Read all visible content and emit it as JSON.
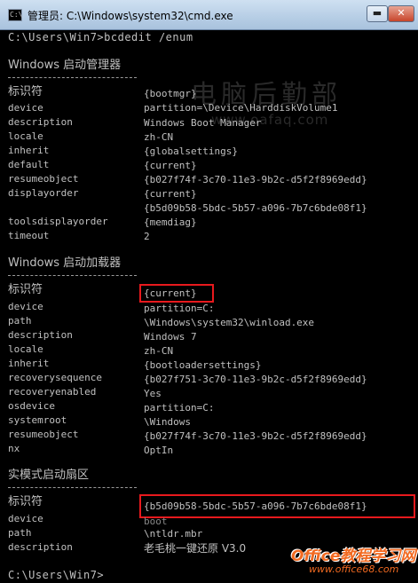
{
  "window": {
    "title": "管理员: C:\\Windows\\system32\\cmd.exe",
    "icon": "cmd-icon"
  },
  "prompt_command": "C:\\Users\\Win7>bcdedit /enum",
  "watermark": {
    "text": "电脑后勤部",
    "url": "www.oafaq.com"
  },
  "sections": [
    {
      "heading": "Windows 启动管理器",
      "entries": [
        {
          "key": "标识符",
          "value": "{bootmgr}"
        },
        {
          "key": "device",
          "value": "partition=\\Device\\HarddiskVolume1"
        },
        {
          "key": "description",
          "value": "Windows Boot Manager"
        },
        {
          "key": "locale",
          "value": "zh-CN"
        },
        {
          "key": "inherit",
          "value": "{globalsettings}"
        },
        {
          "key": "default",
          "value": "{current}"
        },
        {
          "key": "resumeobject",
          "value": "{b027f74f-3c70-11e3-9b2c-d5f2f8969edd}"
        },
        {
          "key": "displayorder",
          "value": "{current}"
        },
        {
          "key": "",
          "value": "{b5d09b58-5bdc-5b57-a096-7b7c6bde08f1}"
        },
        {
          "key": "toolsdisplayorder",
          "value": "{memdiag}"
        },
        {
          "key": "timeout",
          "value": "2"
        }
      ]
    },
    {
      "heading": "Windows 启动加载器",
      "entries": [
        {
          "key": "标识符",
          "value": "{current}"
        },
        {
          "key": "device",
          "value": "partition=C:"
        },
        {
          "key": "path",
          "value": "\\Windows\\system32\\winload.exe"
        },
        {
          "key": "description",
          "value": "Windows 7"
        },
        {
          "key": "locale",
          "value": "zh-CN"
        },
        {
          "key": "inherit",
          "value": "{bootloadersettings}"
        },
        {
          "key": "recoverysequence",
          "value": "{b027f751-3c70-11e3-9b2c-d5f2f8969edd}"
        },
        {
          "key": "recoveryenabled",
          "value": "Yes"
        },
        {
          "key": "osdevice",
          "value": "partition=C:"
        },
        {
          "key": "systemroot",
          "value": "\\Windows"
        },
        {
          "key": "resumeobject",
          "value": "{b027f74f-3c70-11e3-9b2c-d5f2f8969edd}"
        },
        {
          "key": "nx",
          "value": "OptIn"
        }
      ]
    },
    {
      "heading": "实模式启动扇区",
      "entries": [
        {
          "key": "标识符",
          "value": "{b5d09b58-5bdc-5b57-a096-7b7c6bde08f1}"
        },
        {
          "key": "device",
          "value": "boot"
        },
        {
          "key": "path",
          "value": "\\ntldr.mbr"
        },
        {
          "key": "description",
          "value": "老毛桃一键还原 V3.0"
        }
      ]
    }
  ],
  "final_prompt": "C:\\Users\\Win7>",
  "logo": {
    "main": "Office教程学习网",
    "sub": "www.office68.com"
  },
  "colors": {
    "console_bg": "#000000",
    "console_text": "#c0c0c0",
    "highlight": "#e8191d",
    "logo": "#f26a21"
  }
}
